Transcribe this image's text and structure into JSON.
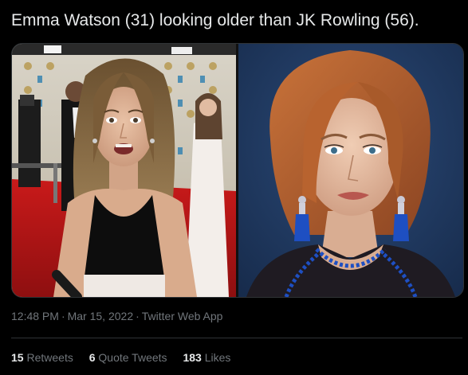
{
  "tweet": {
    "text": "Emma Watson (31) looking older than JK Rowling (56).",
    "time": "12:48 PM",
    "date": "Mar 15, 2022",
    "source": "Twitter Web App",
    "separator": "·"
  },
  "stats": [
    {
      "count": "15",
      "label": "Retweets"
    },
    {
      "count": "6",
      "label": "Quote Tweets"
    },
    {
      "count": "183",
      "label": "Likes"
    }
  ],
  "media": {
    "left_photo": "photo-young-woman-red-carpet",
    "right_photo": "photo-older-woman-blue-background"
  },
  "colors": {
    "background": "#000000",
    "text": "#e7e9ea",
    "muted": "#71767b",
    "border": "#2f3336"
  }
}
